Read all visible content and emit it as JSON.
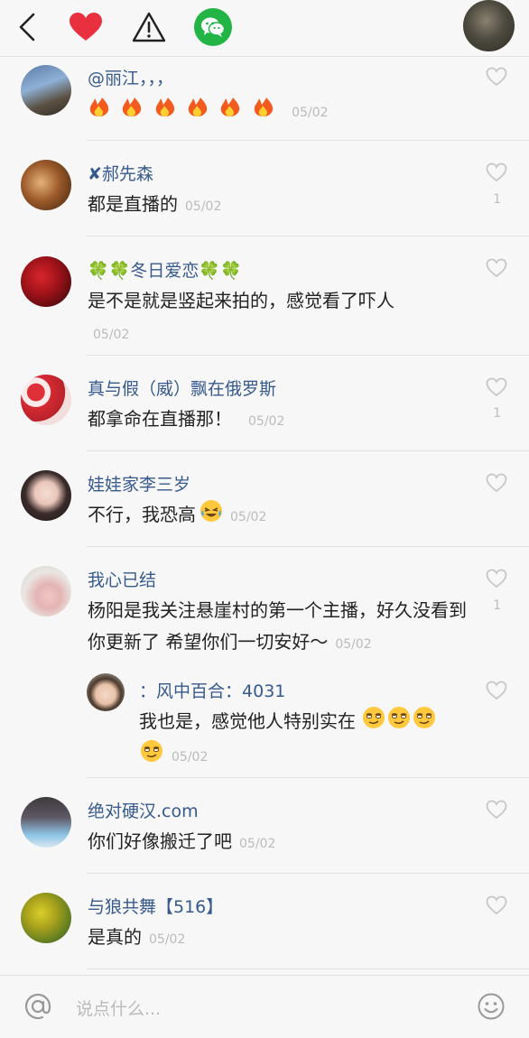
{
  "topbar": {
    "icons": [
      "back-arrow-icon",
      "heart-icon",
      "warning-icon",
      "wechat-icon",
      "user-avatar"
    ]
  },
  "comments": [
    {
      "name": "@丽江，，，",
      "text": "",
      "date": "05/02",
      "likes": "",
      "emoji": [
        "fire",
        "fire",
        "fire",
        "fire",
        "fire",
        "fire"
      ]
    },
    {
      "name": "✘郝先森",
      "text": "都是直播的",
      "date": "05/02",
      "likes": "1"
    },
    {
      "name": "🍀🍀冬日爱恋🍀🍀",
      "text": "是不是就是竖起来拍的，感觉看了吓人",
      "date": "05/02",
      "likes": ""
    },
    {
      "name": "真与假（威）飘在俄罗斯",
      "text": "都拿命在直播那！",
      "date": "05/02",
      "likes": "1"
    },
    {
      "name": "娃娃家李三岁",
      "text": "不行，我恐高",
      "date": "05/02",
      "likes": ""
    },
    {
      "name": "我心已结",
      "text": "杨阳是我关注悬崖村的第一个主播，好久没看到你更新了 希望你们一切安好～",
      "date": "05/02",
      "likes": "1"
    },
    {
      "name": "绝对硬汉.com",
      "text": "你们好像搬迁了吧",
      "date": "05/02",
      "likes": ""
    },
    {
      "name": "与狼共舞【516】",
      "text": "是真的",
      "date": "05/02",
      "likes": ""
    }
  ],
  "reply": {
    "prefix": "：",
    "name": "风中百合：4031",
    "text": "我也是，感觉他人特别实在",
    "date": "05/02"
  },
  "input": {
    "placeholder": "说点什么..."
  },
  "colors": {
    "name": "#375a8c",
    "wechat": "#22b545",
    "heart": "#e8303f",
    "muted": "#bbbbbb"
  }
}
